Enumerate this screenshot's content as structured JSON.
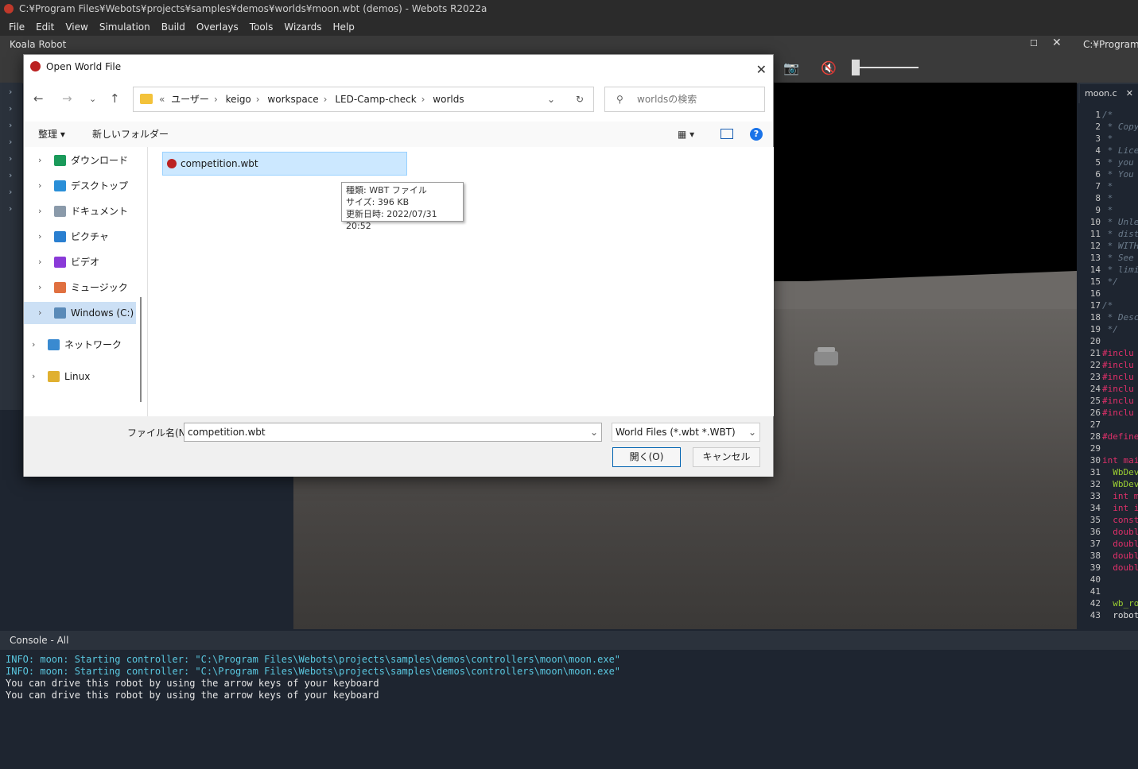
{
  "window": {
    "title": "C:¥Program Files¥Webots¥projects¥samples¥demos¥worlds¥moon.wbt (demos) - Webots R2022a"
  },
  "menu": [
    "File",
    "Edit",
    "View",
    "Simulation",
    "Build",
    "Overlays",
    "Tools",
    "Wizards",
    "Help"
  ],
  "scene_tree": {
    "title": "Koala Robot"
  },
  "editor": {
    "title": "C:¥Program F",
    "tab": "moon.c",
    "lines": [
      {
        "n": "1",
        "t": "/*",
        "c": "cm"
      },
      {
        "n": "2",
        "t": " * Copy",
        "c": "cm"
      },
      {
        "n": "3",
        "t": " *",
        "c": "cm"
      },
      {
        "n": "4",
        "t": " * Lice",
        "c": "cm"
      },
      {
        "n": "5",
        "t": " * you",
        "c": "cm"
      },
      {
        "n": "6",
        "t": " * You",
        "c": "cm"
      },
      {
        "n": "7",
        "t": " *",
        "c": "cm"
      },
      {
        "n": "8",
        "t": " *",
        "c": "cm"
      },
      {
        "n": "9",
        "t": " *",
        "c": "cm"
      },
      {
        "n": "10",
        "t": " * Unle",
        "c": "cm"
      },
      {
        "n": "11",
        "t": " * dist",
        "c": "cm"
      },
      {
        "n": "12",
        "t": " * WITH",
        "c": "cm"
      },
      {
        "n": "13",
        "t": " * See",
        "c": "cm"
      },
      {
        "n": "14",
        "t": " * limi",
        "c": "cm"
      },
      {
        "n": "15",
        "t": " */",
        "c": "cm"
      },
      {
        "n": "16",
        "t": "",
        "c": "df"
      },
      {
        "n": "17",
        "t": "/*",
        "c": "cm"
      },
      {
        "n": "18",
        "t": " * Desc",
        "c": "cm"
      },
      {
        "n": "19",
        "t": " */",
        "c": "cm"
      },
      {
        "n": "20",
        "t": "",
        "c": "df"
      },
      {
        "n": "21",
        "t": "#inclu",
        "c": "pp"
      },
      {
        "n": "22",
        "t": "#inclu",
        "c": "pp"
      },
      {
        "n": "23",
        "t": "#inclu",
        "c": "pp"
      },
      {
        "n": "24",
        "t": "#inclu",
        "c": "pp"
      },
      {
        "n": "25",
        "t": "#inclu",
        "c": "pp"
      },
      {
        "n": "26",
        "t": "#inclu",
        "c": "pp"
      },
      {
        "n": "27",
        "t": "",
        "c": "df"
      },
      {
        "n": "28",
        "t": "#define",
        "c": "pp"
      },
      {
        "n": "29",
        "t": "",
        "c": "df"
      },
      {
        "n": "30",
        "t": "int mai",
        "c": "kw"
      },
      {
        "n": "31",
        "t": "  WbDev",
        "c": "fn"
      },
      {
        "n": "32",
        "t": "  WbDev",
        "c": "fn"
      },
      {
        "n": "33",
        "t": "  int m",
        "c": "kw"
      },
      {
        "n": "34",
        "t": "  int i",
        "c": "kw"
      },
      {
        "n": "35",
        "t": "  const",
        "c": "kw"
      },
      {
        "n": "36",
        "t": "  doubl",
        "c": "kw"
      },
      {
        "n": "37",
        "t": "  doubl",
        "c": "kw"
      },
      {
        "n": "38",
        "t": "  doubl",
        "c": "kw"
      },
      {
        "n": "39",
        "t": "  doubl",
        "c": "kw"
      },
      {
        "n": "40",
        "t": "",
        "c": "df"
      },
      {
        "n": "41",
        "t": "",
        "c": "df"
      },
      {
        "n": "42",
        "t": "  wb_ro",
        "c": "fn"
      },
      {
        "n": "43",
        "t": "  robot",
        "c": "df"
      }
    ]
  },
  "console": {
    "title": "Console - All",
    "lines": [
      {
        "t": "INFO: moon: Starting controller: \"C:\\Program Files\\Webots\\projects\\samples\\demos\\controllers\\moon\\moon.exe\"",
        "c": "info"
      },
      {
        "t": "INFO: moon: Starting controller: \"C:\\Program Files\\Webots\\projects\\samples\\demos\\controllers\\moon\\moon.exe\"",
        "c": "info"
      },
      {
        "t": "You can drive this robot by using the arrow keys of your keyboard",
        "c": "plain"
      },
      {
        "t": "You can drive this robot by using the arrow keys of your keyboard",
        "c": "plain"
      }
    ]
  },
  "dialog": {
    "title": "Open World File",
    "breadcrumb": [
      "ユーザー",
      "keigo",
      "workspace",
      "LED-Camp-check",
      "worlds"
    ],
    "search_placeholder": "worldsの検索",
    "organize": "整理 ▾",
    "new_folder": "新しいフォルダー",
    "nav": [
      {
        "label": "ダウンロード",
        "icon": "download-icon",
        "color": "#1a9a5a"
      },
      {
        "label": "デスクトップ",
        "icon": "desktop-icon",
        "color": "#2a8fd8"
      },
      {
        "label": "ドキュメント",
        "icon": "document-icon",
        "color": "#8a9aaa"
      },
      {
        "label": "ピクチャ",
        "icon": "pictures-icon",
        "color": "#2a7fd0"
      },
      {
        "label": "ビデオ",
        "icon": "video-icon",
        "color": "#8a3ad8"
      },
      {
        "label": "ミュージック",
        "icon": "music-icon",
        "color": "#e07040"
      },
      {
        "label": "Windows (C:)",
        "icon": "drive-icon",
        "color": "#5a8ab8"
      },
      {
        "label": "ネットワーク",
        "icon": "network-icon",
        "color": "#3a8ad0"
      },
      {
        "label": "Linux",
        "icon": "linux-icon",
        "color": "#e0b030"
      }
    ],
    "file": "competition.wbt",
    "tooltip": [
      "種類: WBT ファイル",
      "サイズ: 396 KB",
      "更新日時: 2022/07/31 20:52"
    ],
    "filename_label": "ファイル名(N):",
    "filename_value": "competition.wbt",
    "filter": "World Files (*.wbt *.WBT)",
    "open": "開く(O)",
    "cancel": "キャンセル"
  }
}
